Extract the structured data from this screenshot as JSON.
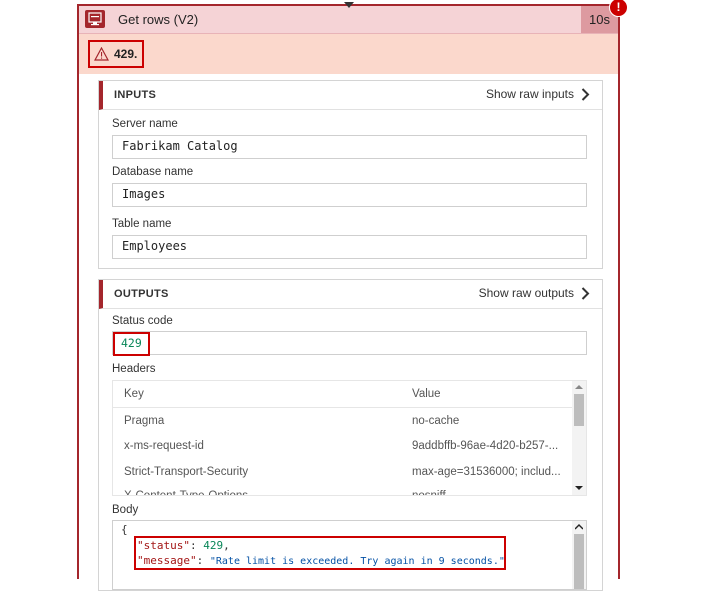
{
  "action": {
    "title": "Get rows (V2)",
    "duration": "10s",
    "error_badge": "!",
    "error_code": "429."
  },
  "inputs": {
    "title": "INPUTS",
    "show_raw_label": "Show raw inputs",
    "fields": [
      {
        "label": "Server name",
        "value": "Fabrikam Catalog"
      },
      {
        "label": "Database name",
        "value": "Images"
      },
      {
        "label": "Table name",
        "value": "Employees"
      }
    ]
  },
  "outputs": {
    "title": "OUTPUTS",
    "show_raw_label": "Show raw outputs",
    "status_code_label": "Status code",
    "status_code": "429",
    "headers_label": "Headers",
    "headers_columns": [
      "Key",
      "Value"
    ],
    "headers_rows": [
      {
        "key": "Pragma",
        "value": "no-cache"
      },
      {
        "key": "x-ms-request-id",
        "value": "9addbffb-96ae-4d20-b257-..."
      },
      {
        "key": "Strict-Transport-Security",
        "value": "max-age=31536000; includ..."
      },
      {
        "key": "X-Content-Type-Options",
        "value": "nosniff"
      }
    ],
    "body_label": "Body",
    "body": {
      "open_brace": "{",
      "status_key": "\"status\"",
      "status_value": "429",
      "message_key": "\"message\"",
      "message_value": "\"Rate limit is exceeded. Try again in 9 seconds.\""
    }
  },
  "colors": {
    "accent": "#a4262c",
    "error_red": "#cc0000",
    "header_bg": "#f5d3d6",
    "error_strip_bg": "#fbd8cc",
    "json_number": "#098658",
    "json_key": "#a31515",
    "json_string": "#0451a5"
  },
  "icons": {
    "action": "sql-server-icon",
    "warning": "warning-icon",
    "chevron": "chevron-right-icon",
    "scroll_up": "scroll-up-arrow-icon",
    "scroll_down": "scroll-down-arrow-icon"
  }
}
